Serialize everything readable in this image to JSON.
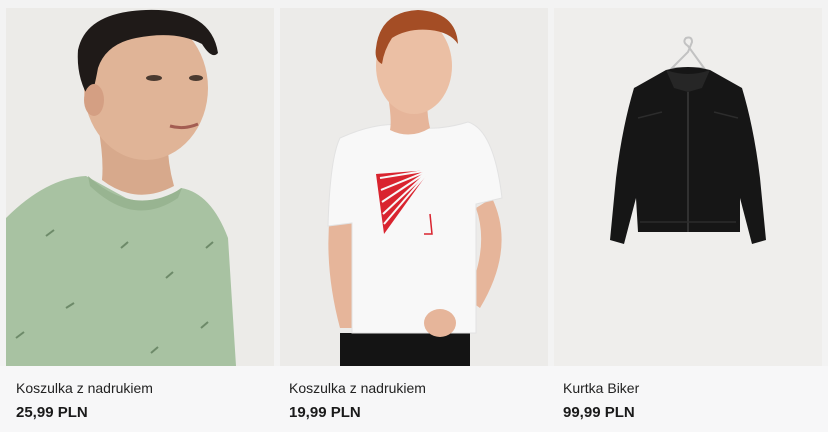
{
  "products": [
    {
      "name": "Koszulka z nadrukiem",
      "price": "25,99 PLN",
      "image": "green-printed-tshirt-model"
    },
    {
      "name": "Koszulka z nadrukiem",
      "price": "19,99 PLN",
      "image": "white-tshirt-red-print-model"
    },
    {
      "name": "Kurtka Biker",
      "price": "99,99 PLN",
      "image": "black-biker-jacket-on-hanger"
    }
  ],
  "colors": {
    "background": "#f3f3f3",
    "tshirt_green": "#a8c2a2",
    "tshirt_white": "#f8f8f8",
    "print_red": "#d9242f",
    "jacket_black": "#161616"
  }
}
